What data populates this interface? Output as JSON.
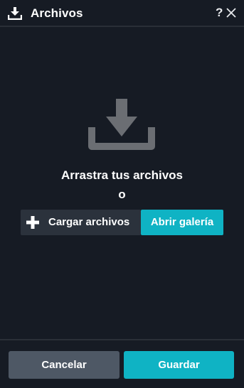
{
  "window": {
    "title": "Archivos",
    "title_icon": "download-icon",
    "help_label": "?",
    "close_icon": "close-icon"
  },
  "dropzone": {
    "icon": "download-tray-icon",
    "drag_text": "Arrastra tus archivos",
    "or_text": "o",
    "upload_button": {
      "icon": "plus-icon",
      "label": "Cargar archivos"
    },
    "gallery_button": {
      "label": "Abrir galería"
    }
  },
  "footer": {
    "cancel_label": "Cancelar",
    "save_label": "Guardar"
  },
  "colors": {
    "background": "#161b24",
    "accent": "#0fb3c4",
    "secondary_button": "#4e5865",
    "upload_button": "#2b323c",
    "icon_gray": "#6b6e73"
  }
}
